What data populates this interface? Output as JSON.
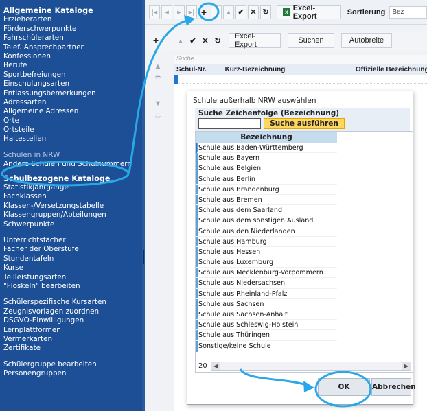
{
  "sidebar": {
    "group1": [
      "Allgemeine Kataloge",
      "Erzieherarten",
      "Förderschwerpunkte",
      "Fahrschülerarten",
      "Telef. Ansprechpartner",
      "Konfessionen",
      "Berufe",
      "Sportbefreiungen",
      "Einschulungsarten",
      "Entlassungsbemerkungen",
      "Adressarten",
      "Allgemeine Adressen",
      "Orte",
      "Ortsteile",
      "Haltestellen"
    ],
    "group2": [
      "Schulen in NRW",
      "Andere Schulen und Schulnummern"
    ],
    "group3": [
      "Schulbezogene Kataloge",
      "Statistikjahrgänge",
      "Fachklassen",
      "Klassen-/Versetzungstabelle",
      "Klassengruppen/Abteilungen",
      "Schwerpunkte"
    ],
    "group4": [
      "Unterrichtsfächer",
      "Fächer der Oberstufe",
      "Stundentafeln",
      "Kurse",
      "Teilleistungsarten",
      "\"Floskeln\" bearbeiten"
    ],
    "group5": [
      "Schülerspezifische Kursarten",
      "Zeugnisvorlagen zuordnen",
      "DSGVO-Einwilligungen",
      "Lernplattformen",
      "Vermerkarten",
      "Zertifikate"
    ],
    "group6": [
      "Schülergruppe bearbeiten",
      "Personengruppen"
    ]
  },
  "toolbar1": {
    "excel_export": "Excel-Export",
    "sort_label": "Sortierung",
    "sort_value": "Bez"
  },
  "toolbar2": {
    "excel_export": "Excel-Export",
    "search": "Suchen",
    "autobreite": "Autobreite"
  },
  "grid": {
    "search_placeholder": "Suche...",
    "col_schulnr": "Schul-Nr.",
    "col_kurz": "Kurz-Bezeichnung",
    "col_offiziell": "Offizielle Bezeichnung"
  },
  "dialog": {
    "title": "Schule außerhalb NRW auswählen",
    "search_label": "Suche Zeichenfolge (Bezeichnung)",
    "search_value": "",
    "search_button": "Suche ausführen",
    "list_header": "Bezeichnung",
    "rows": [
      "Schule aus Baden-Württemberg",
      "Schule aus Bayern",
      "Schule aus Belgien",
      "Schule aus Berlin",
      "Schule aus Brandenburg",
      "Schule aus Bremen",
      "Schule aus dem Saarland",
      "Schule aus dem sonstigen Ausland",
      "Schule aus den Niederlanden",
      "Schule aus Hamburg",
      "Schule aus Hessen",
      "Schule aus Luxemburg",
      "Schule aus Mecklenburg-Vorpommern",
      "Schule aus Niedersachsen",
      "Schule aus Rheinland-Pfalz",
      "Schule aus Sachsen",
      "Schule aus Sachsen-Anhalt",
      "Schule aus Schleswig-Holstein",
      "Schule aus Thüringen",
      "Sonstige/keine Schule"
    ],
    "pager_count": "20",
    "ok": "OK",
    "cancel": "Abbrechen"
  },
  "colors": {
    "sidebar_bg": "#1c4f96",
    "annotation_blue": "#2aa7e6",
    "search_button": "#ffd75e",
    "list_header": "#c5dcee"
  }
}
